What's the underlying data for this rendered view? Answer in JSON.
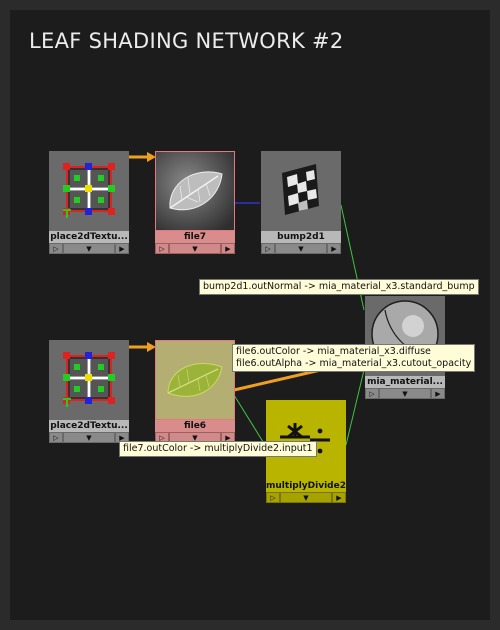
{
  "title": "LEAF SHADING NETWORK #2",
  "nodes": {
    "place2d_top": {
      "label": "place2dTextu..."
    },
    "file7": {
      "label": "file7"
    },
    "bump2d1": {
      "label": "bump2d1"
    },
    "place2d_bottom": {
      "label": "place2dTextu..."
    },
    "file6": {
      "label": "file6"
    },
    "mia_material": {
      "label": "mia_material..."
    },
    "multiply_divide": {
      "label": "multiplyDivide2"
    }
  },
  "port_glyphs": {
    "left": "▷",
    "middle": "▼",
    "right": "▶"
  },
  "tooltips": {
    "bump": "bump2d1.outNormal -> mia_material_x3.standard_bump",
    "diffuse": "file6.outColor -> mia_material_x3.diffuse",
    "cutout": "file6.outAlpha -> mia_material_x3.cutout_opacity",
    "multiply": "file7.outColor -> multiplyDivide2.input1"
  },
  "colors": {
    "background": "#1c1c1c",
    "frame": "#2b2b2b",
    "texture_node": "#d98c8c",
    "utility_node": "#b8b400",
    "wire_orange": "#f0a020",
    "wire_green": "#3ec43e",
    "wire_blue": "#3030d0",
    "tooltip": "#fffcd8"
  }
}
